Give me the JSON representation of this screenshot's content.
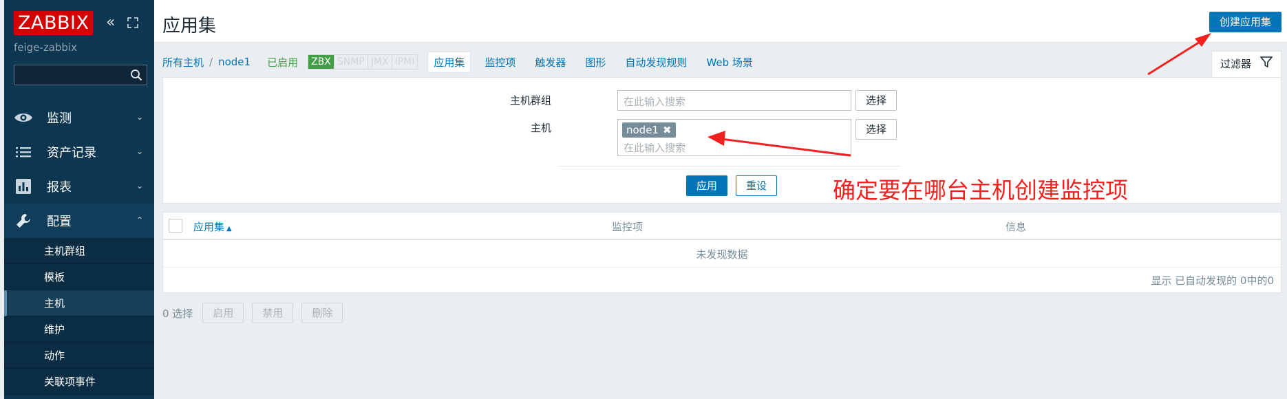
{
  "sidebar": {
    "logo": "ZABBIX",
    "server_name": "feige-zabbix",
    "search_placeholder": "",
    "menu": [
      {
        "label": "监测",
        "icon": "eye-icon",
        "expanded": false
      },
      {
        "label": "资产记录",
        "icon": "list-icon",
        "expanded": false
      },
      {
        "label": "报表",
        "icon": "bar-chart-icon",
        "expanded": false
      },
      {
        "label": "配置",
        "icon": "wrench-icon",
        "expanded": true
      }
    ],
    "submenu": [
      {
        "label": "主机群组"
      },
      {
        "label": "模板"
      },
      {
        "label": "主机",
        "selected": true
      },
      {
        "label": "维护"
      },
      {
        "label": "动作"
      },
      {
        "label": "关联项事件"
      }
    ],
    "collapse_glyph": "«"
  },
  "header": {
    "title": "应用集",
    "create_button": "创建应用集"
  },
  "breadcrumb": {
    "all_hosts": "所有主机",
    "separator": "/",
    "host": "node1",
    "status": "已启用"
  },
  "availability": [
    "ZBX",
    "SNMP",
    "JMX",
    "IPMI"
  ],
  "nav_tabs": [
    "应用集",
    "监控项",
    "触发器",
    "图形",
    "自动发现规则",
    "Web 场景"
  ],
  "filter": {
    "tab_label": "过滤器",
    "host_group_label": "主机群组",
    "host_group_placeholder": "在此输入搜索",
    "host_label": "主机",
    "host_chip": "node1",
    "host_placeholder": "在此输入搜索",
    "select_label": "选择",
    "apply_label": "应用",
    "reset_label": "重设"
  },
  "table": {
    "columns": [
      "应用集",
      "监控项",
      "信息"
    ],
    "sort_indicator": "▲",
    "empty_text": "未发现数据",
    "footer": "显示 已自动发现的 0中的0"
  },
  "actions": {
    "selected_count": "0 选择",
    "buttons": [
      "启用",
      "禁用",
      "删除"
    ]
  },
  "annotation": {
    "text": "确定要在哪台主机创建监控项",
    "color": "#f0211f"
  },
  "colors": {
    "sidebar_bg": "#0d3650",
    "accent": "#0275b8",
    "enabled_green": "#429e47",
    "logo_red": "#d40000"
  }
}
